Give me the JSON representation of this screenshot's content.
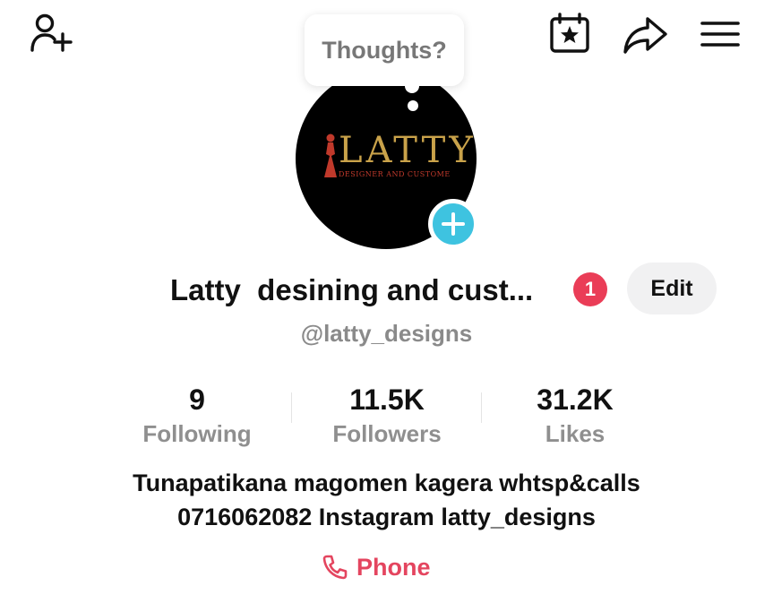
{
  "header": {
    "icons": [
      "add-user-icon",
      "calendar-star-icon",
      "share-icon",
      "menu-icon"
    ]
  },
  "bubble": {
    "text": "Thoughts?"
  },
  "avatar": {
    "logo_main": "LATTY",
    "logo_sub": "DESIGNER AND CUSTOME",
    "colors": {
      "logo_gold": "#c9a24a",
      "logo_red": "#c0392b"
    }
  },
  "profile": {
    "name": "Latty  desining and cust...",
    "notification_count": "1",
    "edit_label": "Edit",
    "handle": "@latty_designs"
  },
  "stats": [
    {
      "value": "9",
      "label": "Following"
    },
    {
      "value": "11.5K",
      "label": "Followers"
    },
    {
      "value": "31.2K",
      "label": "Likes"
    }
  ],
  "bio": {
    "line1": "Tunapatikana magomen kagera whtsp&calls",
    "line2": "0716062082 Instagram latty_designs"
  },
  "phone": {
    "label": "Phone"
  },
  "colors": {
    "accent": "#e4455f",
    "badge": "#ea3d57",
    "add_badge": "#3ec3e0"
  }
}
